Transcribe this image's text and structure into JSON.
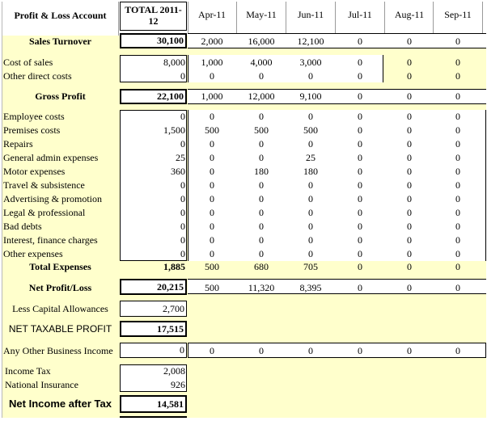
{
  "header": {
    "title": "Profit & Loss Account",
    "total_label": "TOTAL 2011-12",
    "months": [
      "Apr-11",
      "May-11",
      "Jun-11",
      "Jul-11",
      "Aug-11",
      "Sep-11"
    ]
  },
  "sales": {
    "label": "Sales Turnover",
    "total": "30,100",
    "months": [
      "2,000",
      "16,000",
      "12,100",
      "0",
      "0",
      "0"
    ]
  },
  "cost_of_sales": {
    "label": "Cost of sales",
    "total": "8,000",
    "months": [
      "1,000",
      "4,000",
      "3,000",
      "0",
      "0",
      "0"
    ]
  },
  "other_direct": {
    "label": "Other direct costs",
    "total": "0",
    "months": [
      "0",
      "0",
      "0",
      "0",
      "0",
      "0"
    ]
  },
  "gross_profit": {
    "label": "Gross Profit",
    "total": "22,100",
    "months": [
      "1,000",
      "12,000",
      "9,100",
      "0",
      "0",
      "0"
    ]
  },
  "expenses": [
    {
      "label": "Employee costs",
      "total": "0",
      "months": [
        "0",
        "0",
        "0",
        "0",
        "0",
        "0"
      ]
    },
    {
      "label": "Premises costs",
      "total": "1,500",
      "months": [
        "500",
        "500",
        "500",
        "0",
        "0",
        "0"
      ]
    },
    {
      "label": "Repairs",
      "total": "0",
      "months": [
        "0",
        "0",
        "0",
        "0",
        "0",
        "0"
      ]
    },
    {
      "label": "General admin expenses",
      "total": "25",
      "months": [
        "0",
        "0",
        "25",
        "0",
        "0",
        "0"
      ]
    },
    {
      "label": "Motor expenses",
      "total": "360",
      "months": [
        "0",
        "180",
        "180",
        "0",
        "0",
        "0"
      ]
    },
    {
      "label": "Travel & subsistence",
      "total": "0",
      "months": [
        "0",
        "0",
        "0",
        "0",
        "0",
        "0"
      ]
    },
    {
      "label": "Advertising & promotion",
      "total": "0",
      "months": [
        "0",
        "0",
        "0",
        "0",
        "0",
        "0"
      ]
    },
    {
      "label": "Legal & professional",
      "total": "0",
      "months": [
        "0",
        "0",
        "0",
        "0",
        "0",
        "0"
      ]
    },
    {
      "label": "Bad debts",
      "total": "0",
      "months": [
        "0",
        "0",
        "0",
        "0",
        "0",
        "0"
      ]
    },
    {
      "label": "Interest, finance charges",
      "total": "0",
      "months": [
        "0",
        "0",
        "0",
        "0",
        "0",
        "0"
      ]
    },
    {
      "label": "Other expenses",
      "total": "0",
      "months": [
        "0",
        "0",
        "0",
        "0",
        "0",
        "0"
      ]
    }
  ],
  "total_expenses": {
    "label": "Total Expenses",
    "total": "1,885",
    "months": [
      "500",
      "680",
      "705",
      "0",
      "0",
      "0"
    ]
  },
  "net_profit": {
    "label": "Net Profit/Loss",
    "total": "20,215",
    "months": [
      "500",
      "11,320",
      "8,395",
      "0",
      "0",
      "0"
    ]
  },
  "capital_allowances": {
    "label": "Less Capital Allowances",
    "total": "2,700"
  },
  "net_taxable": {
    "label": "NET TAXABLE PROFIT",
    "total": "17,515"
  },
  "other_income": {
    "label": "Any Other Business Income",
    "total": "0",
    "months": [
      "0",
      "0",
      "0",
      "0",
      "0",
      "0"
    ]
  },
  "income_tax": {
    "label": "Income Tax",
    "total": "2,008"
  },
  "national_insurance": {
    "label": "National Insurance",
    "total": "926"
  },
  "net_income": {
    "label": "Net Income after Tax",
    "total": "14,581"
  }
}
